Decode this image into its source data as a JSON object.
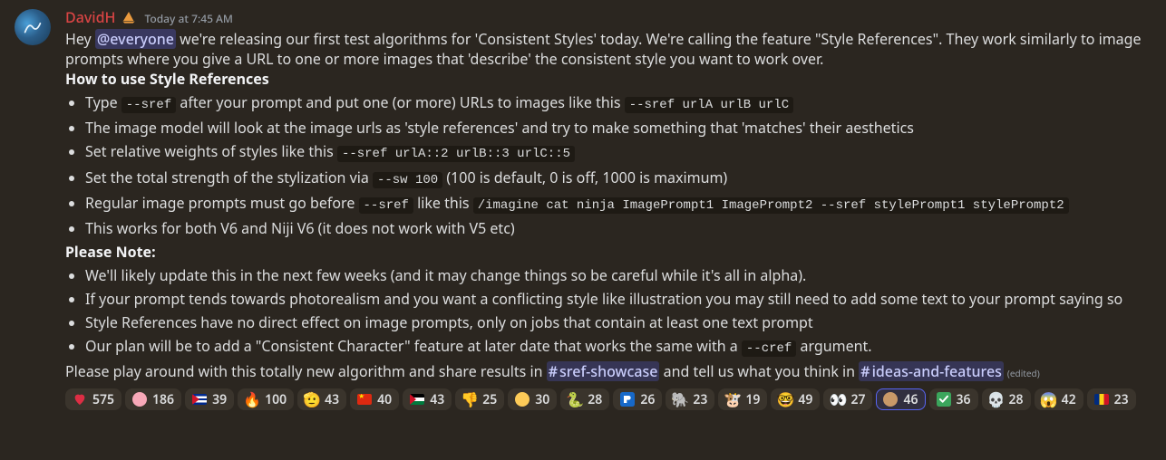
{
  "author": {
    "name": "DavidH",
    "color": "#d84444"
  },
  "timestamp": "Today at 7:45 AM",
  "intro": {
    "prefix": "Hey ",
    "mention": "@everyone",
    "rest": " we're releasing our first test algorithms for 'Consistent Styles' today. We're calling the feature \"Style References\". They work similarly to image prompts where you give a URL to one or more images that 'describe' the consistent style you want to work over."
  },
  "howto_head": "How to use Style References",
  "howto": {
    "b1a": "Type ",
    "b1code1": "--sref",
    "b1b": " after your prompt and put one (or more) URLs to images like this ",
    "b1code2": "--sref urlA urlB urlC",
    "b2": "The image model will look at the image urls as 'style references' and try to make something that 'matches' their aesthetics",
    "b3a": "Set relative weights of styles like this ",
    "b3code": "--sref urlA::2 urlB::3 urlC::5",
    "b4a": "Set the total strength of the stylization via ",
    "b4code": "--sw 100",
    "b4b": " (100 is default, 0 is off, 1000 is maximum)",
    "b5a": "Regular image prompts must go before ",
    "b5code1": "--sref",
    "b5b": " like this ",
    "b5code2": "/imagine cat ninja ImagePrompt1 ImagePrompt2 --sref stylePrompt1 stylePrompt2",
    "b6": "This works for both V6 and Niji V6 (it does not work with V5 etc)"
  },
  "note_head": "Please Note:",
  "notes": {
    "n1": "We'll likely update this in the next few weeks (and it may change things so be careful while it's all in alpha).",
    "n2": "If your prompt tends towards photorealism and you want a conflicting style like illustration you may still need to add some text to your prompt saying so",
    "n3": "Style References have no direct effect on image prompts, only on jobs that contain at least one text prompt",
    "n4a": "Our plan will be to add a \"Consistent Character\" feature at later date that works the same with a ",
    "n4code": "--cref",
    "n4b": " argument."
  },
  "closing": {
    "a": "Please play around with this totally new algorithm and share results in ",
    "ch1": "sref-showcase",
    "b": " and tell us what you think in ",
    "ch2": "ideas-and-features"
  },
  "edited": "(edited)",
  "reactions": [
    {
      "name": "heart",
      "count": 575
    },
    {
      "name": "blob-pink",
      "count": 186
    },
    {
      "name": "flag-cu",
      "count": 39
    },
    {
      "name": "fire",
      "count": 100
    },
    {
      "name": "salute",
      "count": 43
    },
    {
      "name": "flag-cn",
      "count": 40
    },
    {
      "name": "flag-ps",
      "count": 43
    },
    {
      "name": "thumbs-down",
      "count": 25
    },
    {
      "name": "blob-yellow",
      "count": 30
    },
    {
      "name": "snake",
      "count": 28
    },
    {
      "name": "ps-logo",
      "count": 26
    },
    {
      "name": "elephant",
      "count": 23
    },
    {
      "name": "cow",
      "count": 19
    },
    {
      "name": "nerd",
      "count": 49
    },
    {
      "name": "eyes",
      "count": 27
    },
    {
      "name": "blob-brown",
      "count": 46,
      "me": true
    },
    {
      "name": "check",
      "count": 36
    },
    {
      "name": "skull",
      "count": 28
    },
    {
      "name": "scream",
      "count": 42
    },
    {
      "name": "flag-ro",
      "count": 23
    }
  ]
}
